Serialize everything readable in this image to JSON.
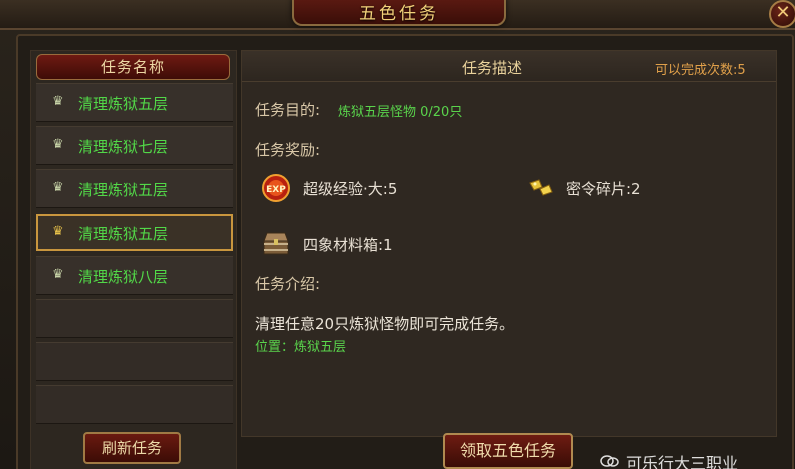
{
  "window": {
    "title": "五色任务",
    "close_label": "✕"
  },
  "task_list": {
    "header": "任务名称",
    "items": [
      {
        "label": "清理炼狱五层",
        "selected": false
      },
      {
        "label": "清理炼狱七层",
        "selected": false
      },
      {
        "label": "清理炼狱五层",
        "selected": false
      },
      {
        "label": "清理炼狱五层",
        "selected": true
      },
      {
        "label": "清理炼狱八层",
        "selected": false
      }
    ],
    "refresh_label": "刷新任务"
  },
  "detail": {
    "header": "任务描述",
    "completion": "可以完成次数:5",
    "objective_label": "任务目的:",
    "objective_value": "炼狱五层怪物 0/20只",
    "rewards_label": "任务奖励:",
    "rewards": [
      {
        "icon": "exp-orb-icon",
        "text": "超级经验·大:5"
      },
      {
        "icon": "token-fragment-icon",
        "text": "密令碎片:2"
      },
      {
        "icon": "treasure-chest-icon",
        "text": "四象材料箱:1"
      }
    ],
    "intro_label": "任务介绍:",
    "intro_text": "清理任意20只炼狱怪物即可完成任务。",
    "location": "位置：炼狱五层"
  },
  "claim_label": "领取五色任务",
  "watermark": {
    "text": "可乐行大三职业"
  },
  "colors": {
    "green_text": "#52d848",
    "gold_text": "#e9d29b",
    "accent_orange": "#e0a04a"
  }
}
